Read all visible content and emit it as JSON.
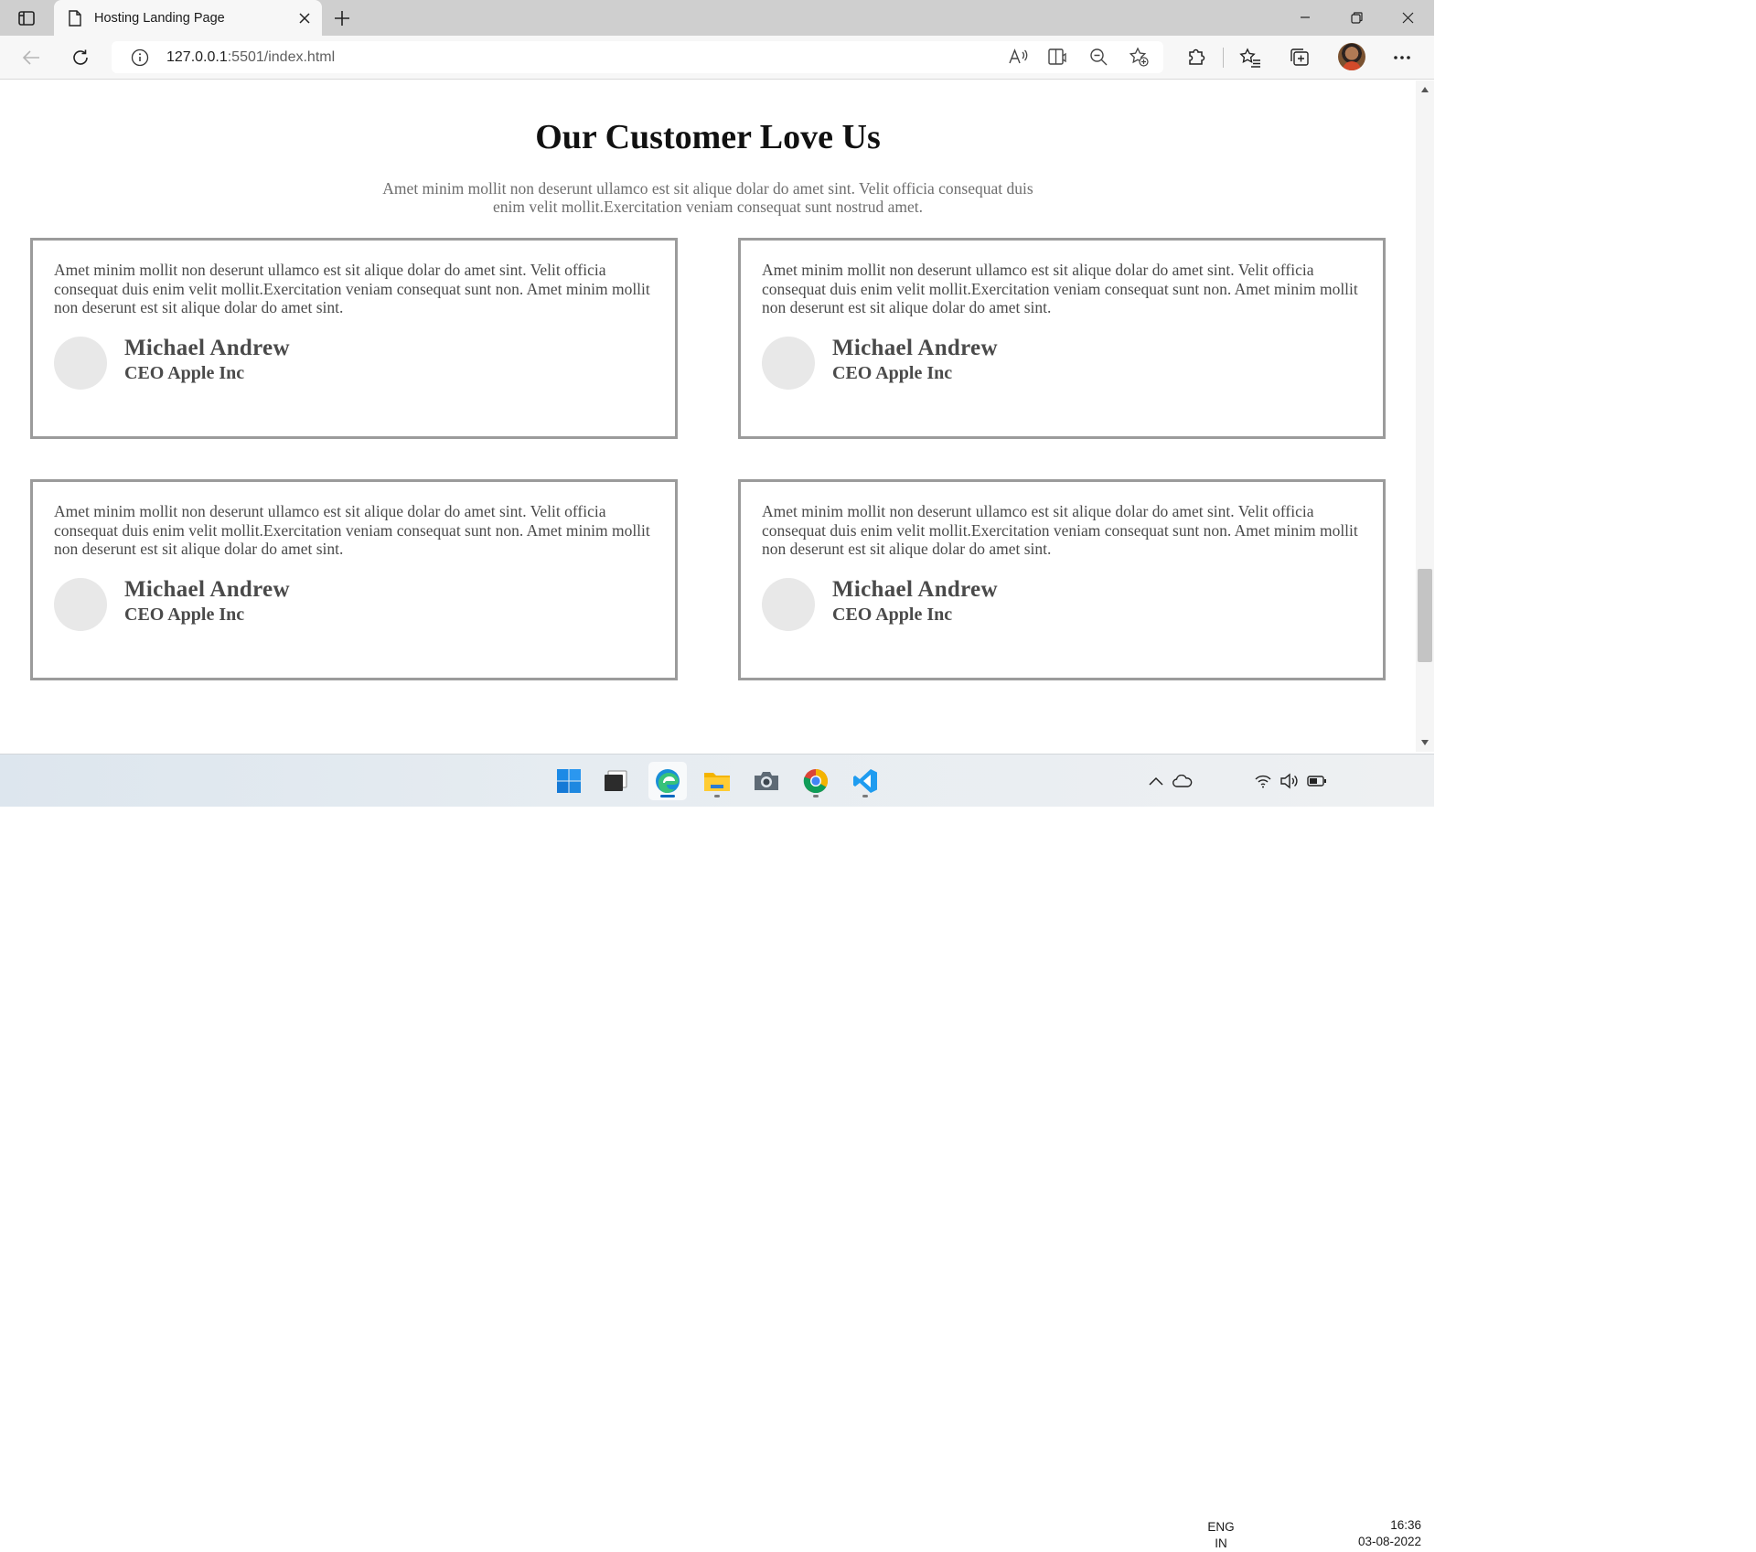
{
  "browser": {
    "tab_title": "Hosting Landing Page",
    "url_host": "127.0.0.1",
    "url_rest": ":5501/index.html"
  },
  "page": {
    "heading": "Our Customer Love Us",
    "subtitle": "Amet minim mollit non deserunt ullamco est sit alique dolar do amet sint. Velit officia consequat duis enim velit mollit.Exercitation veniam consequat sunt nostrud amet.",
    "testimonials": [
      {
        "quote": "Amet minim mollit non deserunt ullamco est sit alique dolar do amet sint. Velit officia consequat duis enim velit mollit.Exercitation veniam consequat sunt non. Amet minim mollit non deserunt est sit alique dolar do amet sint.",
        "name": "Michael Andrew",
        "role": "CEO Apple Inc"
      },
      {
        "quote": "Amet minim mollit non deserunt ullamco est sit alique dolar do amet sint. Velit officia consequat duis enim velit mollit.Exercitation veniam consequat sunt non. Amet minim mollit non deserunt est sit alique dolar do amet sint.",
        "name": "Michael Andrew",
        "role": "CEO Apple Inc"
      },
      {
        "quote": "Amet minim mollit non deserunt ullamco est sit alique dolar do amet sint. Velit officia consequat duis enim velit mollit.Exercitation veniam consequat sunt non. Amet minim mollit non deserunt est sit alique dolar do amet sint.",
        "name": "Michael Andrew",
        "role": "CEO Apple Inc"
      },
      {
        "quote": "Amet minim mollit non deserunt ullamco est sit alique dolar do amet sint. Velit officia consequat duis enim velit mollit.Exercitation veniam consequat sunt non. Amet minim mollit non deserunt est sit alique dolar do amet sint.",
        "name": "Michael Andrew",
        "role": "CEO Apple Inc"
      }
    ]
  },
  "taskbar": {
    "apps": [
      "start-menu",
      "terminal",
      "edge",
      "file-explorer",
      "camera",
      "chrome",
      "vscode"
    ],
    "active_app": "edge",
    "language_line1": "ENG",
    "language_line2": "IN",
    "time": "16:36",
    "date": "03-08-2022"
  },
  "colors": {
    "card_border": "#9b9b9b",
    "body_text": "#4a4a4a",
    "subtitle_text": "#6e6e6e",
    "avatar_placeholder": "#e8e8e8",
    "accent": "#0067c0"
  }
}
